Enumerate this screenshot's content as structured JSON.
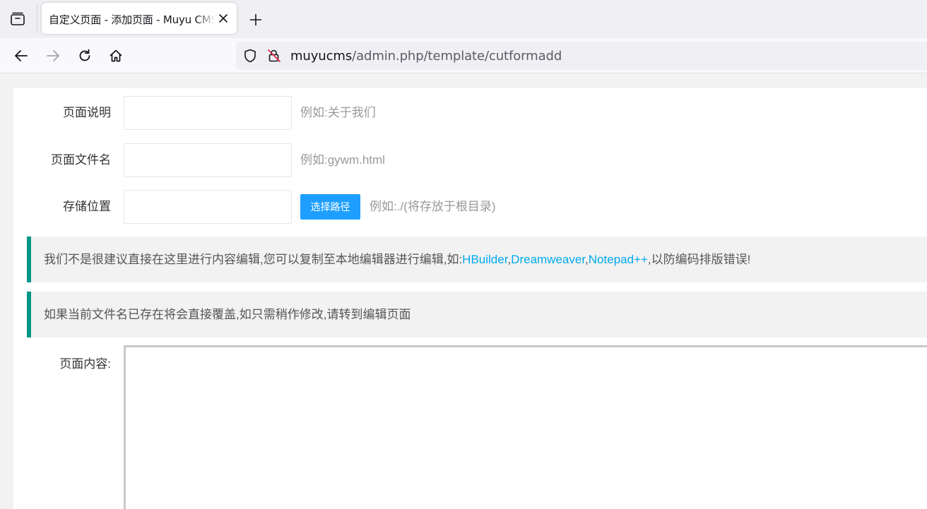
{
  "browser": {
    "tab_title": "自定义页面 - 添加页面 - Muyu CMS",
    "url_host": "muyucms",
    "url_path": "/admin.php/template/cutformadd",
    "icons": {
      "tab_list": "tab-list-icon",
      "close": "close-icon",
      "new_tab": "plus-icon",
      "back": "arrow-left-icon",
      "forward": "arrow-right-icon",
      "reload": "reload-icon",
      "home": "home-icon",
      "tracking": "shield-icon",
      "insecure": "insecure-lock-icon"
    }
  },
  "form": {
    "page_desc_label": "页面说明",
    "page_desc_value": "",
    "page_desc_hint": "例如:关于我们",
    "file_name_label": "页面文件名",
    "file_name_value": "",
    "file_name_hint": "例如:gywm.html",
    "location_label": "存储位置",
    "location_value": "",
    "choose_path_button": "选择路径",
    "location_hint": "例如:./(将存放于根目录)",
    "content_label": "页面内容:",
    "content_value": ""
  },
  "notices": {
    "editor_tip": {
      "prefix": "我们不是很建议直接在这里进行内容编辑,您可以复制至本地编辑器进行编辑,如:",
      "link1": "HBuilder",
      "sep1": ",",
      "link2": "Dreamweaver",
      "sep2": ",",
      "link3": "Notepad++",
      "suffix": ",以防编码排版错误!"
    },
    "overwrite_tip": "如果当前文件名已存在将会直接覆盖,如只需稍作修改,请转到编辑页面"
  },
  "colors": {
    "accent_button": "#1e9fff",
    "quote_border": "#009688",
    "link": "#01aaed"
  }
}
